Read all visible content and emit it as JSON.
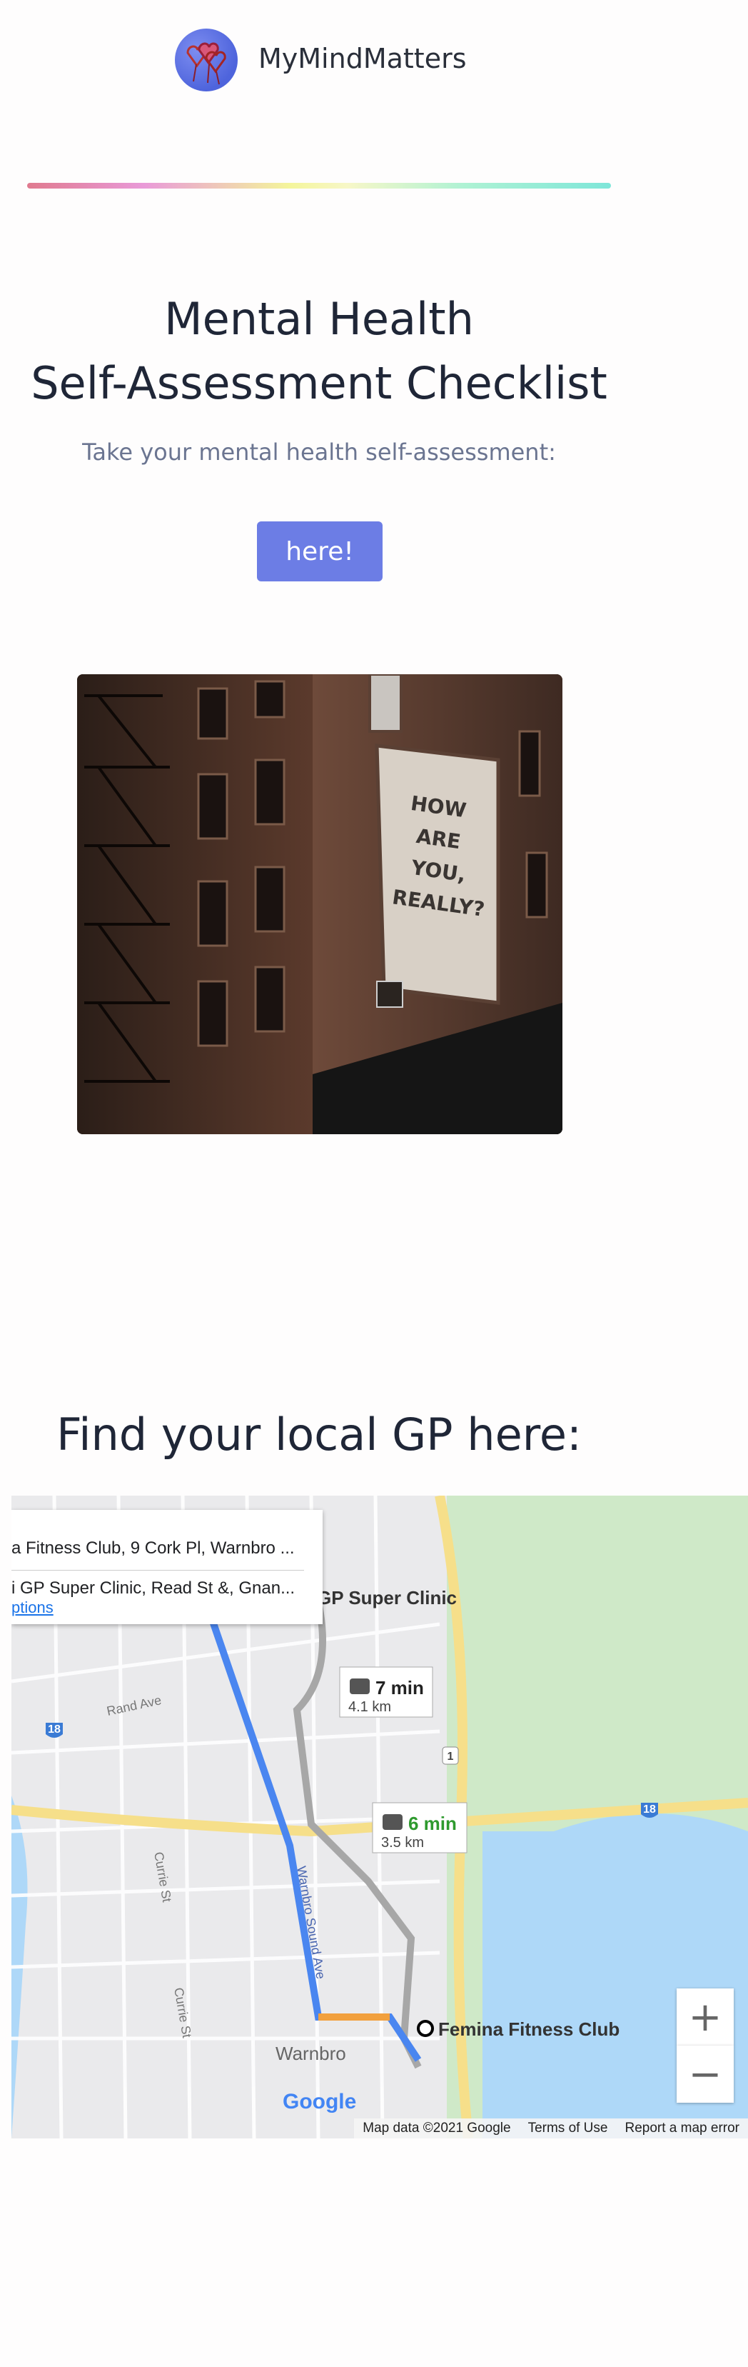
{
  "header": {
    "brand": "MyMindMatters",
    "logo_icon": "hearts-logo-icon"
  },
  "hero": {
    "title_line1": "Mental Health",
    "title_line2": "Self-Assessment Checklist",
    "subtitle": "Take your mental health self-assessment:",
    "cta_label": "here!"
  },
  "photo": {
    "sign_lines": [
      "HOW",
      "ARE",
      "YOU,",
      "REALLY?"
    ]
  },
  "gp": {
    "heading": "Find your local GP here:"
  },
  "map": {
    "origin": "a Fitness Club, 9 Cork Pl, Warnbro ...",
    "destination": "i GP Super Clinic, Read St &, Gnan...",
    "options_link": "ptions",
    "place_clinic": "GP Super Clinic",
    "place_fitness": "Femina Fitness Club",
    "suburb": "Warnbro",
    "street_rand": "Rand Ave",
    "street_currie1": "Currie St",
    "street_currie2": "Currie St",
    "street_warnbro": "Warnbro Sound Ave",
    "route1_time": "7 min",
    "route1_dist": "4.1 km",
    "route2_time": "6 min",
    "route2_dist": "3.5 km",
    "road_badge_18a": "18",
    "road_badge_18b": "18",
    "road_badge_1": "1",
    "zoom_in": "+",
    "zoom_out": "−",
    "google": "Google",
    "attribution_data": "Map data ©2021 Google",
    "attribution_terms": "Terms of Use",
    "attribution_report": "Report a map error"
  }
}
